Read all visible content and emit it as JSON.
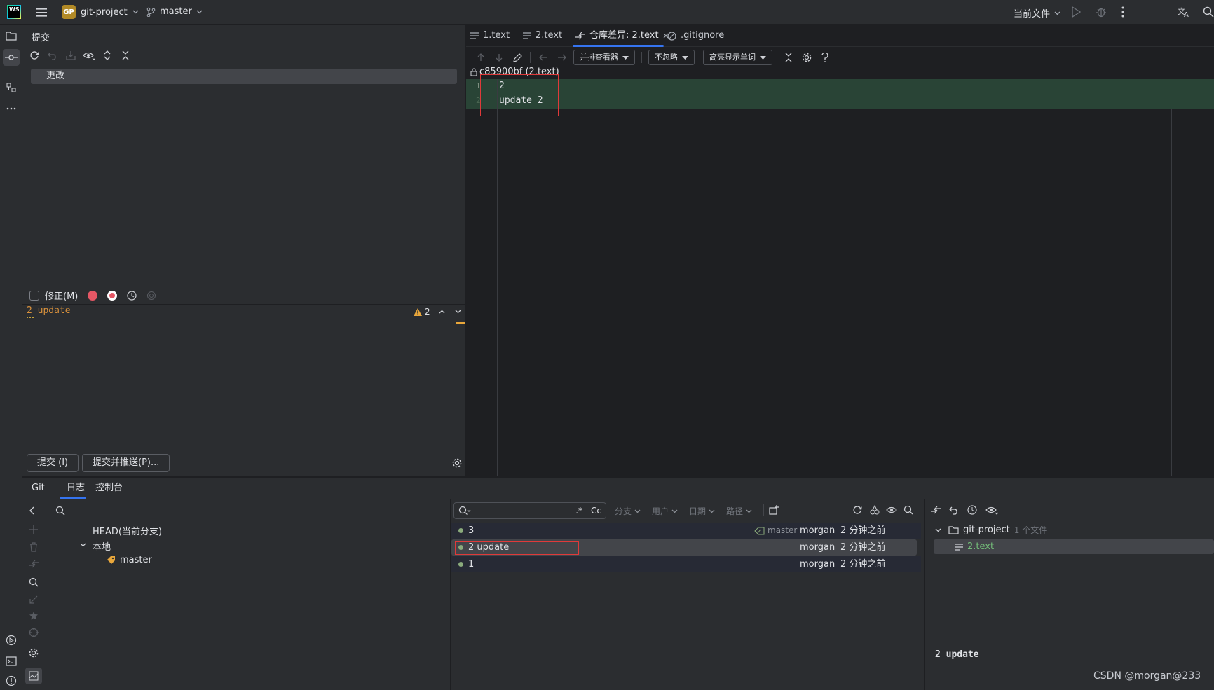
{
  "titlebar": {
    "logo_text": "WS",
    "project_badge": "GP",
    "project_name": "git-project",
    "branch": "master",
    "run_config": "当前文件"
  },
  "commit_panel": {
    "title": "提交",
    "changes_label": "更改",
    "amend_label": "修正(M)",
    "message": "2 update",
    "warning_count": "2",
    "commit_button": "提交 (I)",
    "commit_push_button": "提交并推送(P)..."
  },
  "editor": {
    "tabs": [
      {
        "label": "1.text"
      },
      {
        "label": "2.text"
      },
      {
        "label": "仓库差异: 2.text"
      },
      {
        "label": ".gitignore"
      }
    ],
    "viewer_dropdown": "并排查看器",
    "ignore_dropdown": "不忽略",
    "highlight_dropdown": "高亮显示单词",
    "revision_label": "c85900bf (2.text)",
    "lines": [
      {
        "num": "1",
        "text": "2"
      },
      {
        "num": "2",
        "text": "update 2"
      }
    ]
  },
  "bottom": {
    "tabs": [
      {
        "label": "Git"
      },
      {
        "label": "日志"
      },
      {
        "label": "控制台"
      }
    ],
    "branches": {
      "head": "HEAD(当前分支)",
      "local": "本地",
      "master": "master"
    },
    "filters": {
      "regex": ".*",
      "case": "Cc",
      "branch": "分支",
      "user": "用户",
      "date": "日期",
      "path": "路径"
    },
    "commits": [
      {
        "msg": "3",
        "ref": "master",
        "author": "morgan",
        "time": "2 分钟之前"
      },
      {
        "msg": "2 update",
        "ref": "",
        "author": "morgan",
        "time": "2 分钟之前"
      },
      {
        "msg": "1",
        "ref": "",
        "author": "morgan",
        "time": "2 分钟之前"
      }
    ],
    "details": {
      "root": "git-project",
      "file_count": "1 个文件",
      "file": "2.text",
      "commit_message": "2 update"
    }
  },
  "watermark": "CSDN @morgan@233",
  "colors": {
    "accent": "#3574f0",
    "added_line": "#294436",
    "highlight_box": "#e03a3a",
    "selected_row": "#43454a",
    "added_file": "#73bd79"
  }
}
